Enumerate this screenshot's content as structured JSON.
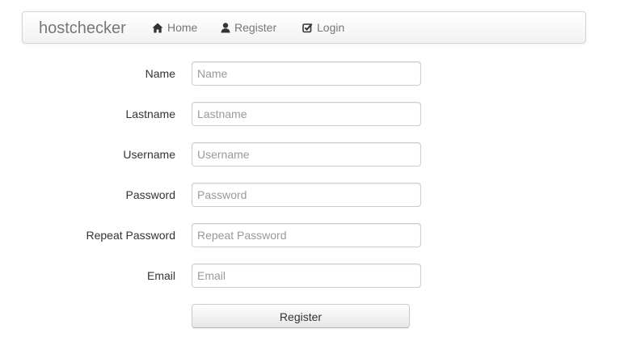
{
  "navbar": {
    "brand": "hostchecker",
    "items": [
      {
        "label": "Home",
        "icon": "home-icon"
      },
      {
        "label": "Register",
        "icon": "user-icon"
      },
      {
        "label": "Login",
        "icon": "check-icon"
      }
    ]
  },
  "form": {
    "fields": [
      {
        "label": "Name",
        "placeholder": "Name",
        "value": ""
      },
      {
        "label": "Lastname",
        "placeholder": "Lastname",
        "value": ""
      },
      {
        "label": "Username",
        "placeholder": "Username",
        "value": ""
      },
      {
        "label": "Password",
        "placeholder": "Password",
        "value": ""
      },
      {
        "label": "Repeat Password",
        "placeholder": "Repeat Password",
        "value": ""
      },
      {
        "label": "Email",
        "placeholder": "Email",
        "value": ""
      }
    ],
    "submit_label": "Register"
  },
  "colors": {
    "nav_text": "#777777",
    "nav_border": "#d4d4d4",
    "input_border": "#cccccc",
    "placeholder": "#999999"
  }
}
